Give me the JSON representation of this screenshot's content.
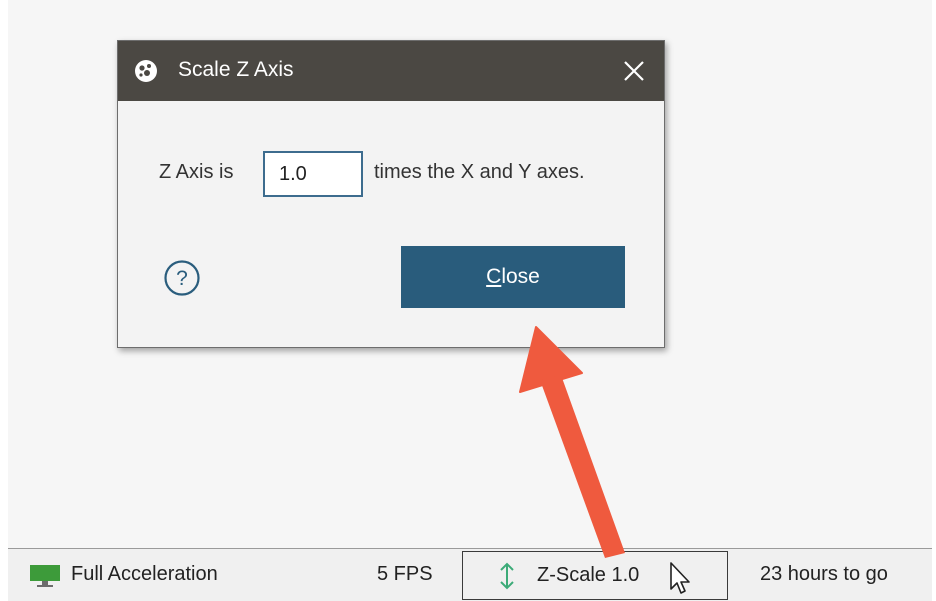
{
  "dialog": {
    "title": "Scale Z Axis",
    "prefix_label": "Z Axis is",
    "scale_value": "1.0",
    "suffix_label": "times the X and Y axes.",
    "close_button": {
      "mnemonic": "C",
      "rest": "lose"
    },
    "help_icon": "help-circle-icon",
    "close_icon": "close-x-icon"
  },
  "statusbar": {
    "acceleration": "Full Acceleration",
    "fps": "5 FPS",
    "zscale": "Z-Scale 1.0",
    "time_remaining": "23 hours to go",
    "icons": [
      "monitor-icon",
      "vertical-arrows-icon",
      "mouse-pointer-icon"
    ]
  },
  "colors": {
    "titlebar": "#4b4843",
    "primary_button": "#295c7c",
    "input_border": "#3d6c8e",
    "annotation_arrow": "#ef5a3e",
    "zscale_icon": "#3cab78"
  }
}
